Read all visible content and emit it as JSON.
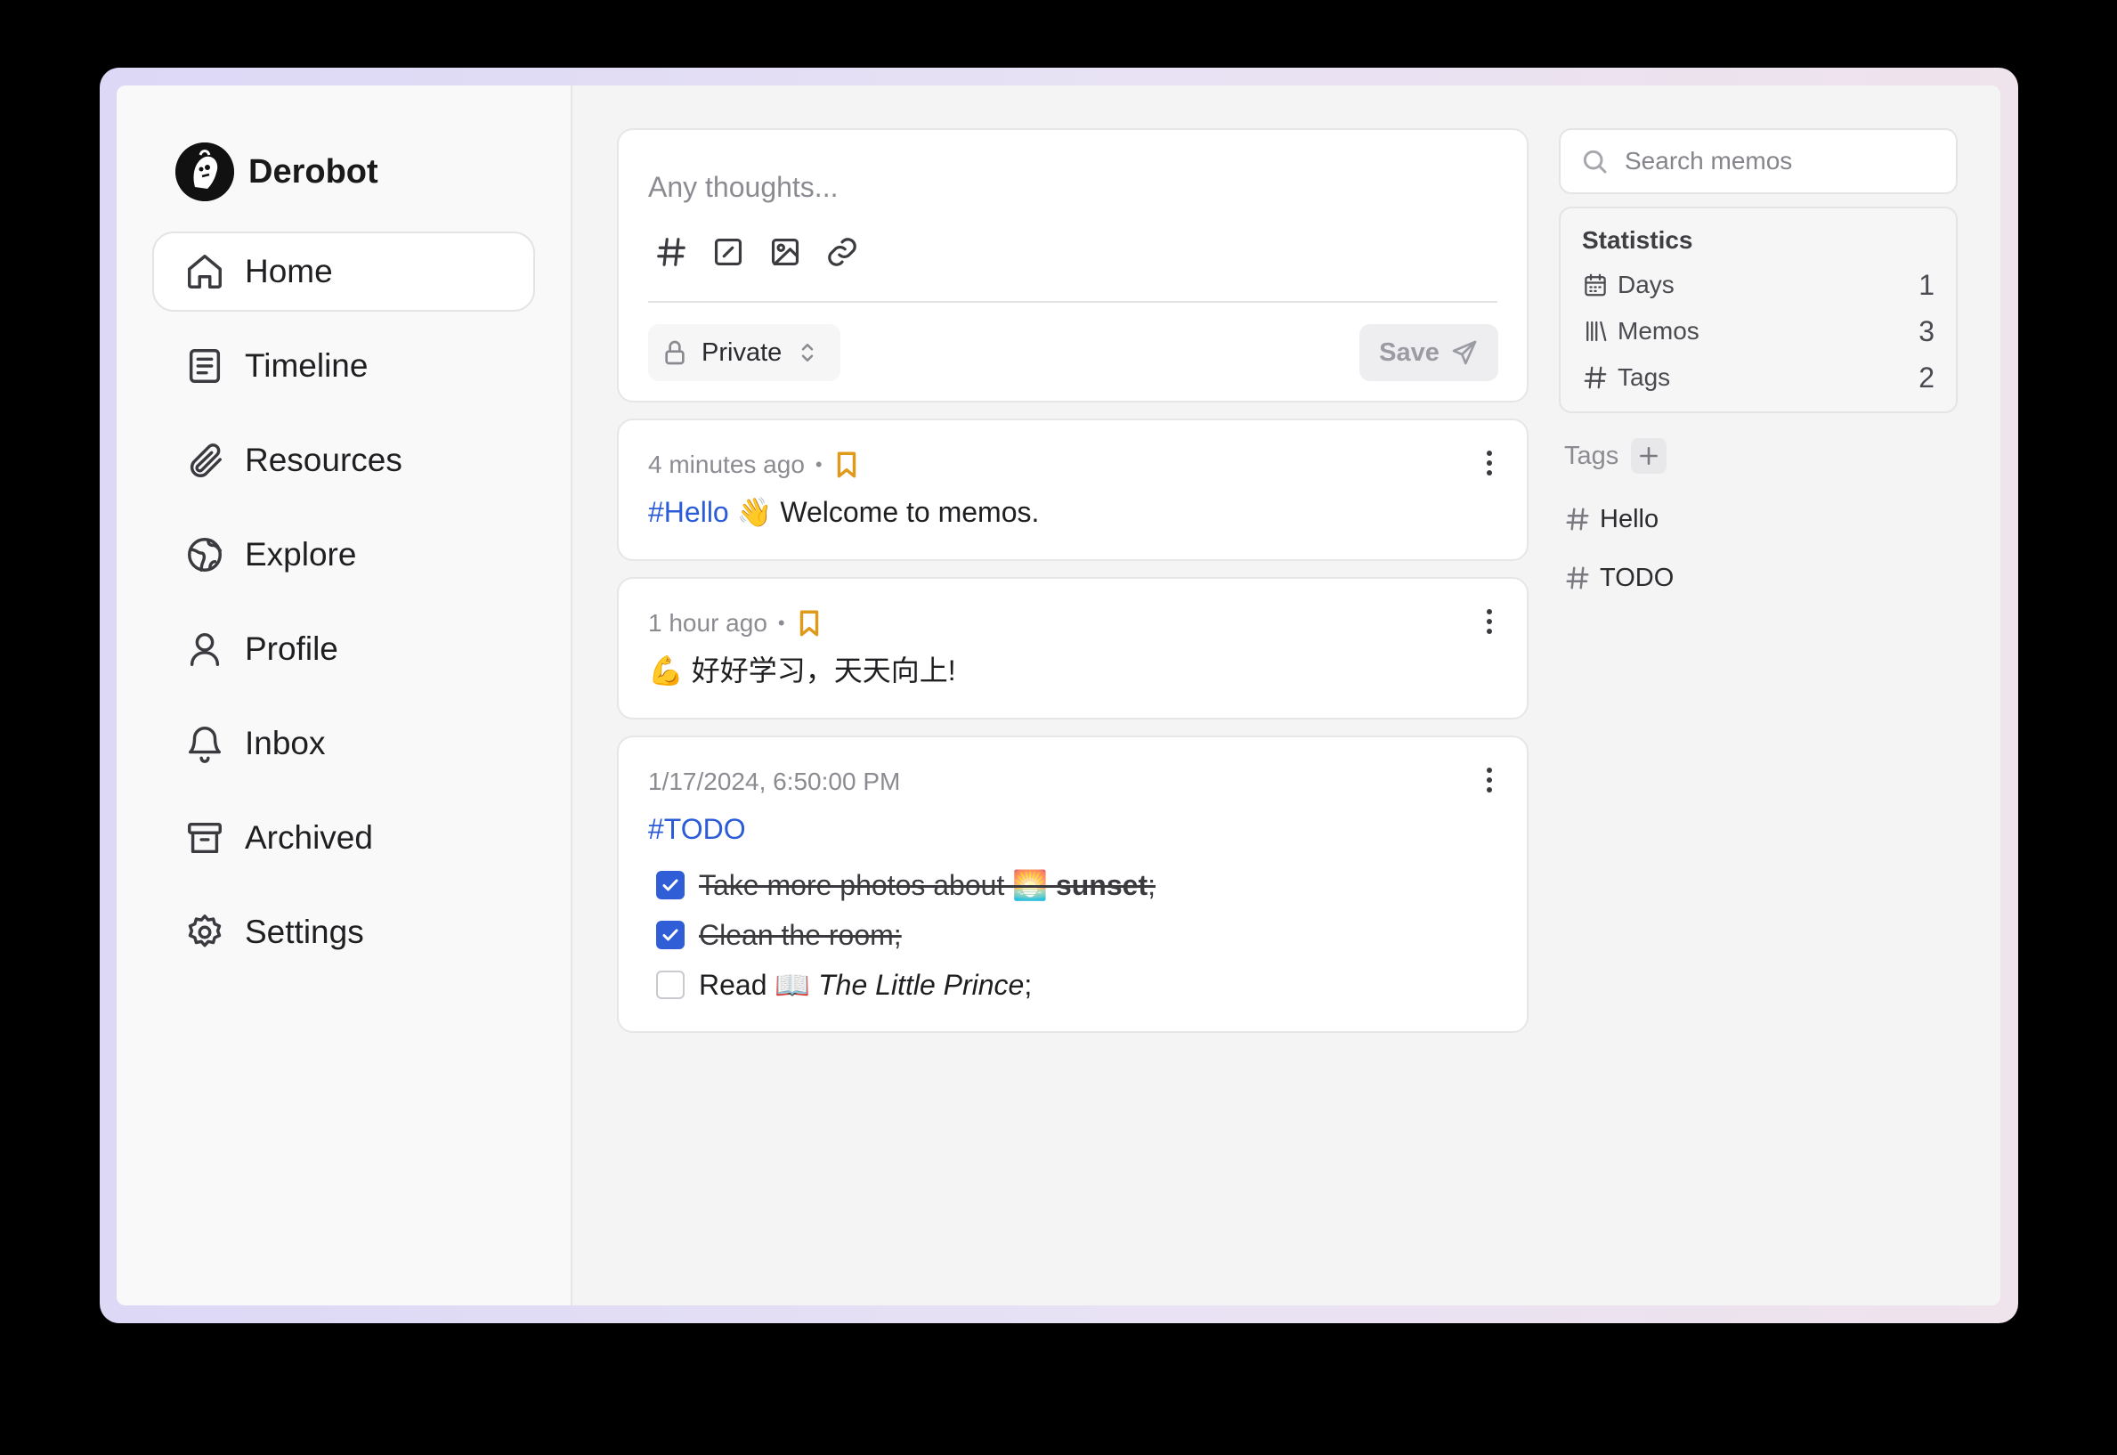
{
  "brand": {
    "name": "Derobot"
  },
  "nav": [
    {
      "label": "Home",
      "icon": "home-icon",
      "active": true
    },
    {
      "label": "Timeline",
      "icon": "timeline-icon"
    },
    {
      "label": "Resources",
      "icon": "paperclip-icon"
    },
    {
      "label": "Explore",
      "icon": "globe-icon"
    },
    {
      "label": "Profile",
      "icon": "user-icon"
    },
    {
      "label": "Inbox",
      "icon": "bell-icon"
    },
    {
      "label": "Archived",
      "icon": "archive-icon"
    },
    {
      "label": "Settings",
      "icon": "gear-icon"
    }
  ],
  "editor": {
    "placeholder": "Any thoughts...",
    "visibility": "Private",
    "save_label": "Save"
  },
  "memos": [
    {
      "time": "4 minutes ago",
      "tag": "#Hello",
      "text": " 👋 Welcome to memos."
    },
    {
      "time": "1 hour ago",
      "text": "💪 好好学习，天天向上!"
    },
    {
      "time": "1/17/2024, 6:50:00 PM",
      "tag": "#TODO",
      "todos": [
        {
          "text_before": "Take more photos about 🌅 ",
          "text_bold": "sunset",
          "text_after": ";",
          "checked": true
        },
        {
          "text": "Clean the room;",
          "checked": true
        },
        {
          "text_before": "Read 📖 ",
          "text_italic": "The Little Prince",
          "text_after": ";",
          "checked": false
        }
      ]
    }
  ],
  "search": {
    "placeholder": "Search memos"
  },
  "statistics": {
    "title": "Statistics",
    "rows": [
      {
        "label": "Days",
        "value": "1",
        "icon": "calendar-icon"
      },
      {
        "label": "Memos",
        "value": "3",
        "icon": "library-icon"
      },
      {
        "label": "Tags",
        "value": "2",
        "icon": "hash-icon"
      }
    ]
  },
  "tags": {
    "title": "Tags",
    "items": [
      "Hello",
      "TODO"
    ]
  },
  "colors": {
    "accent": "#2f5ed6",
    "tag_link": "#2b5bd7",
    "bookmark": "#e09a1a"
  }
}
